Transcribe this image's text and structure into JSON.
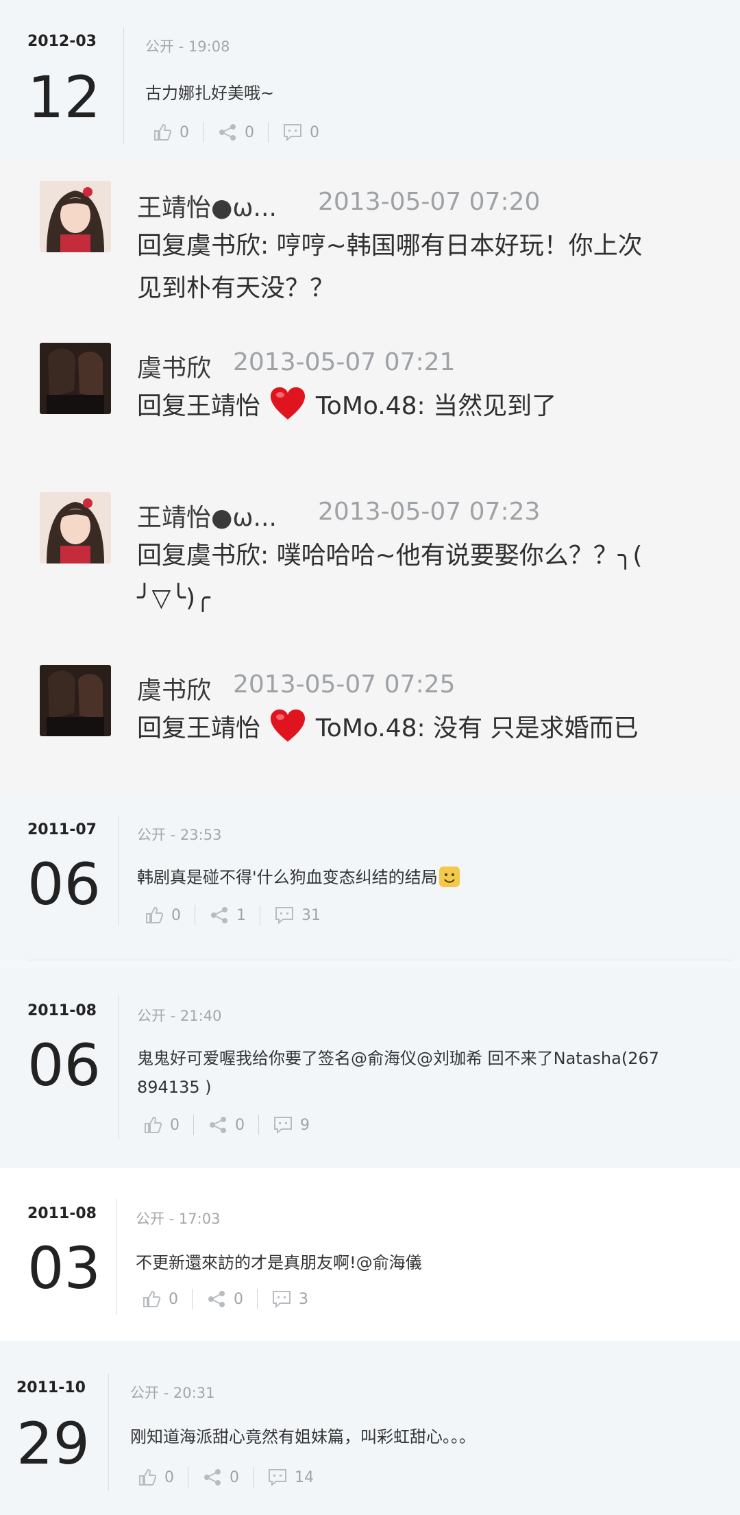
{
  "posts": [
    {
      "ym": "2012-03",
      "day": "12",
      "meta": "公开 - 19:08",
      "text": "古力娜扎好美哦~",
      "likes": "0",
      "shares": "0",
      "comments": "0"
    },
    {
      "ym": "2011-07",
      "day": "06",
      "meta": "公开 - 23:53",
      "text": "韩剧真是碰不得'什么狗血变态纠结的结局",
      "likes": "0",
      "shares": "1",
      "comments": "31"
    },
    {
      "ym": "2011-08",
      "day": "06",
      "meta": "公开 - 21:40",
      "text1": "鬼鬼好可爱喔我给你要了签名@俞海仪@刘珈希 回不来了Natasha(267",
      "text2": "894135 )",
      "likes": "0",
      "shares": "0",
      "comments": "9"
    },
    {
      "ym": "2011-08",
      "day": "03",
      "meta": "公开 - 17:03",
      "text": "不更新還來訪的才是真朋友啊!@俞海儀",
      "likes": "0",
      "shares": "0",
      "comments": "3"
    },
    {
      "ym": "2011-10",
      "day": "29",
      "meta": "公开 - 20:31",
      "text": "刚知道海派甜心竟然有姐妹篇，叫彩虹甜心。。。",
      "likes": "0",
      "shares": "0",
      "comments": "14"
    }
  ],
  "replies": [
    {
      "name": "王靖怡●ω...",
      "time": "2013-05-07 07:20",
      "line1": "回复虞书欣: 哼哼~韩国哪有日本好玩！你上次",
      "line2": "见到朴有天没？？"
    },
    {
      "name": "虞书欣",
      "time": "2013-05-07 07:21",
      "line1a": "回复王靖怡",
      "line1b": "ToMo.48: 当然见到了"
    },
    {
      "name": "王靖怡●ω...",
      "time": "2013-05-07 07:23",
      "line1": "回复虞书欣: 噗哈哈哈~他有说要娶你么？？╮(",
      "line2": "╯▽╰)╭"
    },
    {
      "name": "虞书欣",
      "time": "2013-05-07 07:25",
      "line1a": "回复王靖怡",
      "line1b": "ToMo.48: 没有 只是求婚而已"
    }
  ],
  "colors": {
    "heart": "#e0141e",
    "page_bg": "#f6f7f9",
    "reply_bg": "#f5f5f5"
  }
}
